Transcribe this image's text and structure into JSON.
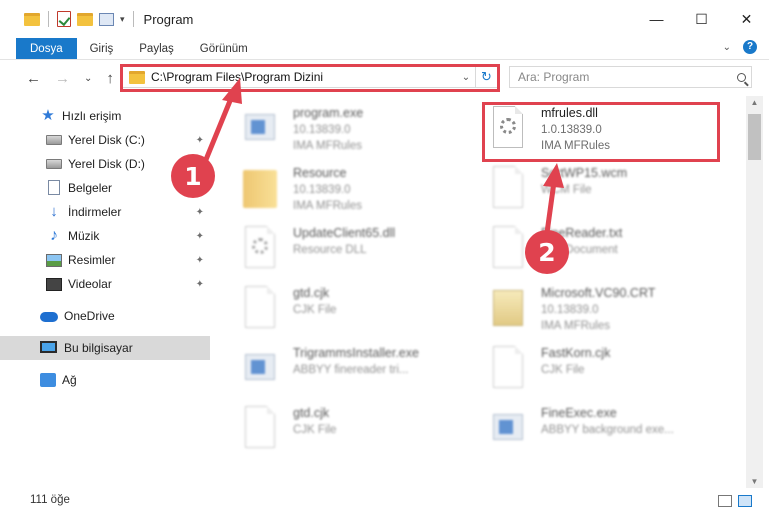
{
  "window": {
    "title": "Program",
    "controls": {
      "minimize": "—",
      "maximize": "☐",
      "close": "✕"
    }
  },
  "ribbon": {
    "tabs": [
      "Dosya",
      "Giriş",
      "Paylaş",
      "Görünüm"
    ],
    "help": "?"
  },
  "address": {
    "path": "C:\\Program Files\\Program Dizini",
    "search_placeholder": "Ara: Program"
  },
  "sidebar": {
    "items": [
      {
        "label": "Hızlı erişim",
        "icon": "star-icon"
      },
      {
        "label": "Yerel Disk (C:)",
        "icon": "drive-icon",
        "pinned": true
      },
      {
        "label": "Yerel Disk (D:)",
        "icon": "drive-icon",
        "pinned": true
      },
      {
        "label": "Belgeler",
        "icon": "document-icon",
        "pinned": true
      },
      {
        "label": "İndirmeler",
        "icon": "download-icon",
        "pinned": true
      },
      {
        "label": "Müzik",
        "icon": "music-icon",
        "pinned": true
      },
      {
        "label": "Resimler",
        "icon": "pictures-icon",
        "pinned": true
      },
      {
        "label": "Videolar",
        "icon": "videos-icon",
        "pinned": true
      },
      {
        "label": "OneDrive",
        "icon": "cloud-icon"
      },
      {
        "label": "Bu bilgisayar",
        "icon": "computer-icon",
        "selected": true
      },
      {
        "label": "Ağ",
        "icon": "network-icon"
      }
    ]
  },
  "files": [
    {
      "name": "program.exe",
      "line1": "10.13839.0",
      "line2": "IMA MFRules",
      "icon": "app-icon"
    },
    {
      "name": "mfrules.dll",
      "line1": "1.0.13839.0",
      "line2": "IMA MFRules",
      "icon": "settings-file-icon"
    },
    {
      "name": "Resource",
      "line1": "10.13839.0",
      "line2": "IMA MFRules",
      "icon": "folder-icon"
    },
    {
      "name": "SortWP15.wcm",
      "line1": "WCM File",
      "line2": "",
      "icon": "file-icon"
    },
    {
      "name": "UpdateClient65.dll",
      "line1": "Resource DLL",
      "line2": "",
      "icon": "settings-file-icon"
    },
    {
      "name": "FineReader.txt",
      "line1": "Text Document",
      "line2": "",
      "icon": "file-icon"
    },
    {
      "name": "gtd.cjk",
      "line1": "CJK File",
      "line2": "",
      "icon": "file-icon"
    },
    {
      "name": "Microsoft.VC90.CRT",
      "line1": "10.13839.0",
      "line2": "IMA MFRules",
      "icon": "package-icon"
    },
    {
      "name": "TrigrammsInstaller.exe",
      "line1": "ABBYY finereader tri...",
      "line2": "",
      "icon": "app-icon"
    },
    {
      "name": "FastKorn.cjk",
      "line1": "CJK File",
      "line2": "",
      "icon": "file-icon"
    },
    {
      "name": "gtd.cjk",
      "line1": "CJK File",
      "line2": "",
      "icon": "file-icon"
    },
    {
      "name": "FineExec.exe",
      "line1": "ABBYY background exe...",
      "line2": "",
      "icon": "app-icon"
    }
  ],
  "annotations": {
    "badge1": "1",
    "badge2": "2"
  },
  "status": {
    "count": "111 öğe"
  },
  "colors": {
    "accent": "#1979ca",
    "highlight": "#e0424f"
  }
}
